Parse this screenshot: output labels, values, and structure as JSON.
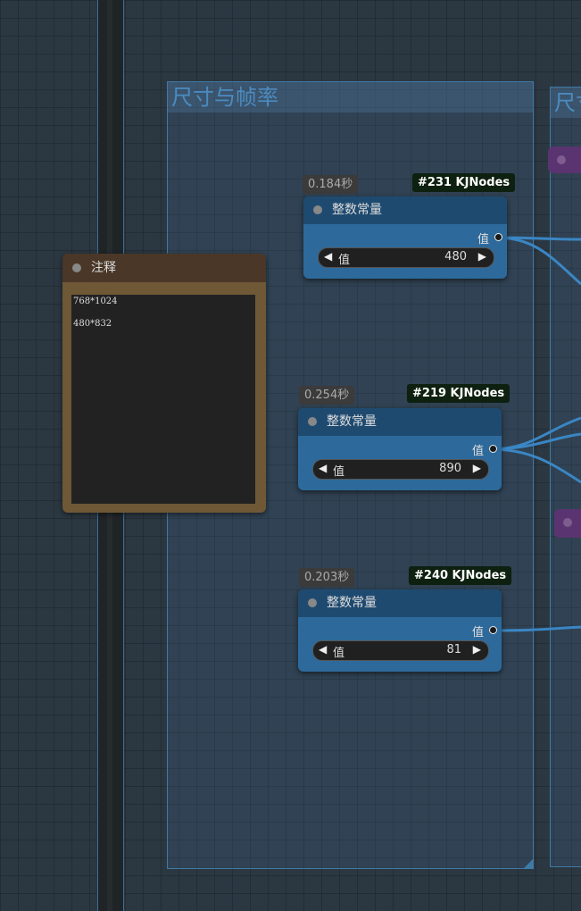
{
  "groups": [
    {
      "title": "尺寸与帧率"
    },
    {
      "title": "尺寸"
    }
  ],
  "note": {
    "title": "注释",
    "lines": [
      "768*1024",
      "480*832"
    ]
  },
  "nodes": [
    {
      "time": "0.184秒",
      "id": "#231 KJNodes",
      "title": "整数常量",
      "output_label": "值",
      "widget_label": "值",
      "value": "480"
    },
    {
      "time": "0.254秒",
      "id": "#219 KJNodes",
      "title": "整数常量",
      "output_label": "值",
      "widget_label": "值",
      "value": "890"
    },
    {
      "time": "0.203秒",
      "id": "#240 KJNodes",
      "title": "整数常量",
      "output_label": "值",
      "widget_label": "值",
      "value": "81"
    }
  ],
  "colors": {
    "canvas": "#2b3741",
    "group_border": "#3f7aa6",
    "node_body": "#2d6a9b",
    "node_header": "#1f4a70",
    "note_body": "#6e5836",
    "badge_id_bg": "#0e200f",
    "link": "#3a86c4",
    "purple_node": "#5a3470"
  },
  "icons": {
    "decrement": "triangle-left",
    "increment": "triangle-right",
    "status_dot": "circle",
    "output_port": "circle-outline"
  }
}
